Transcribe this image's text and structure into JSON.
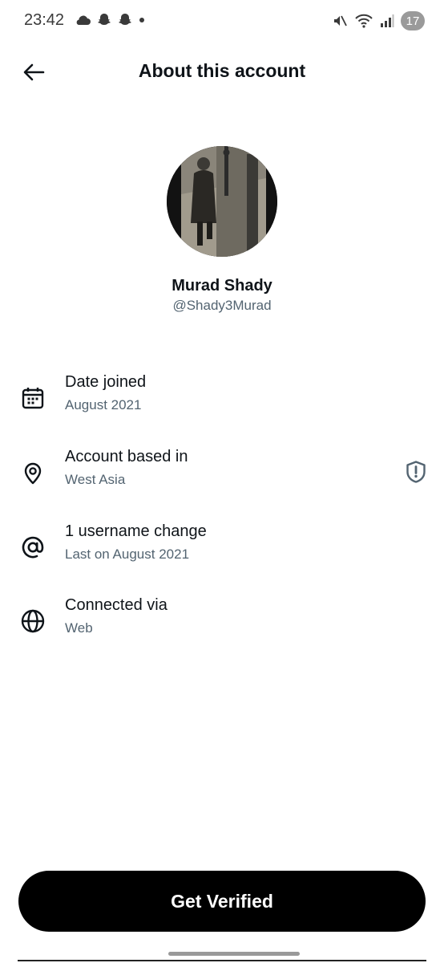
{
  "status_bar": {
    "time": "23:42",
    "left_icons": [
      "cloud-icon",
      "snapchat-ghost-icon",
      "snapchat-ghost-icon",
      "dot-icon"
    ],
    "right_icons": [
      "mute-icon",
      "wifi-icon",
      "signal-icon"
    ],
    "battery": "17"
  },
  "header": {
    "title": "About this account",
    "back_icon": "arrow-left-icon"
  },
  "profile": {
    "name": "Murad Shady",
    "handle": "@Shady3Murad"
  },
  "info_rows": [
    {
      "icon": "calendar-icon",
      "title": "Date joined",
      "value": "August 2021"
    },
    {
      "icon": "location-pin-icon",
      "title": "Account based in",
      "value": "West Asia",
      "right_icon": "shield-alert-icon"
    },
    {
      "icon": "at-sign-icon",
      "title": "1 username change",
      "value": "Last on August 2021"
    },
    {
      "icon": "globe-icon",
      "title": "Connected via",
      "value": "Web"
    }
  ],
  "cta": {
    "label": "Get Verified"
  },
  "colors": {
    "text_primary": "#0f1419",
    "text_secondary": "#536471",
    "button_bg": "#000000",
    "button_text": "#ffffff"
  }
}
